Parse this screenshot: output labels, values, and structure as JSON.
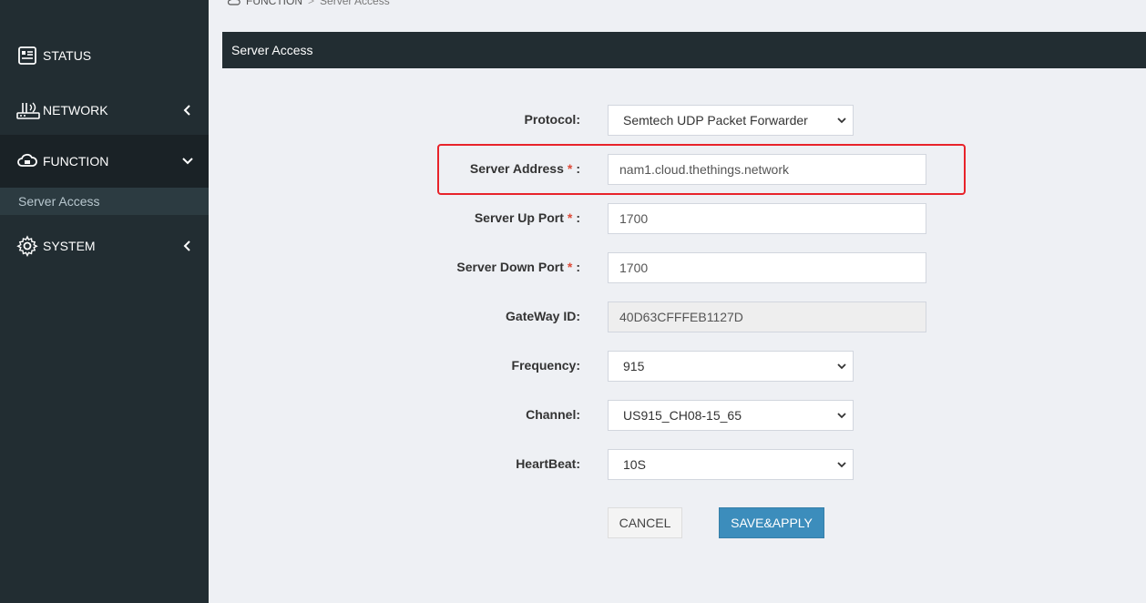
{
  "breadcrumb": {
    "parent": "FUNCTION",
    "separator": ">",
    "current": "Server Access"
  },
  "sidebar": {
    "items": [
      {
        "label": "STATUS",
        "icon": "status-icon"
      },
      {
        "label": "NETWORK",
        "icon": "network-icon"
      },
      {
        "label": "FUNCTION",
        "icon": "cloud-icon"
      },
      {
        "label": "SYSTEM",
        "icon": "gear-icon"
      }
    ],
    "sub_items": [
      {
        "label": "Server Access"
      }
    ]
  },
  "panel": {
    "title": "Server Access"
  },
  "form": {
    "protocol": {
      "label": "Protocol:",
      "value": "Semtech UDP Packet Forwarder"
    },
    "server_address": {
      "label": "Server Address",
      "required": "*",
      "colon": ":",
      "value": "nam1.cloud.thethings.network"
    },
    "server_up_port": {
      "label": "Server Up Port",
      "required": "*",
      "colon": ":",
      "value": "1700"
    },
    "server_down_port": {
      "label": "Server Down Port",
      "required": "*",
      "colon": ":",
      "value": "1700"
    },
    "gateway_id": {
      "label": "GateWay ID:",
      "value": "40D63CFFFEB1127D"
    },
    "frequency": {
      "label": "Frequency:",
      "value": "915"
    },
    "channel": {
      "label": "Channel:",
      "value": "US915_CH08-15_65"
    },
    "heartbeat": {
      "label": "HeartBeat:",
      "value": "10S"
    }
  },
  "buttons": {
    "cancel": "CANCEL",
    "save": "SAVE&APPLY"
  },
  "colors": {
    "sidebar": "#222d32",
    "accent": "#3c8dbc",
    "highlight": "#e8232a",
    "required": "#dd4b39"
  }
}
